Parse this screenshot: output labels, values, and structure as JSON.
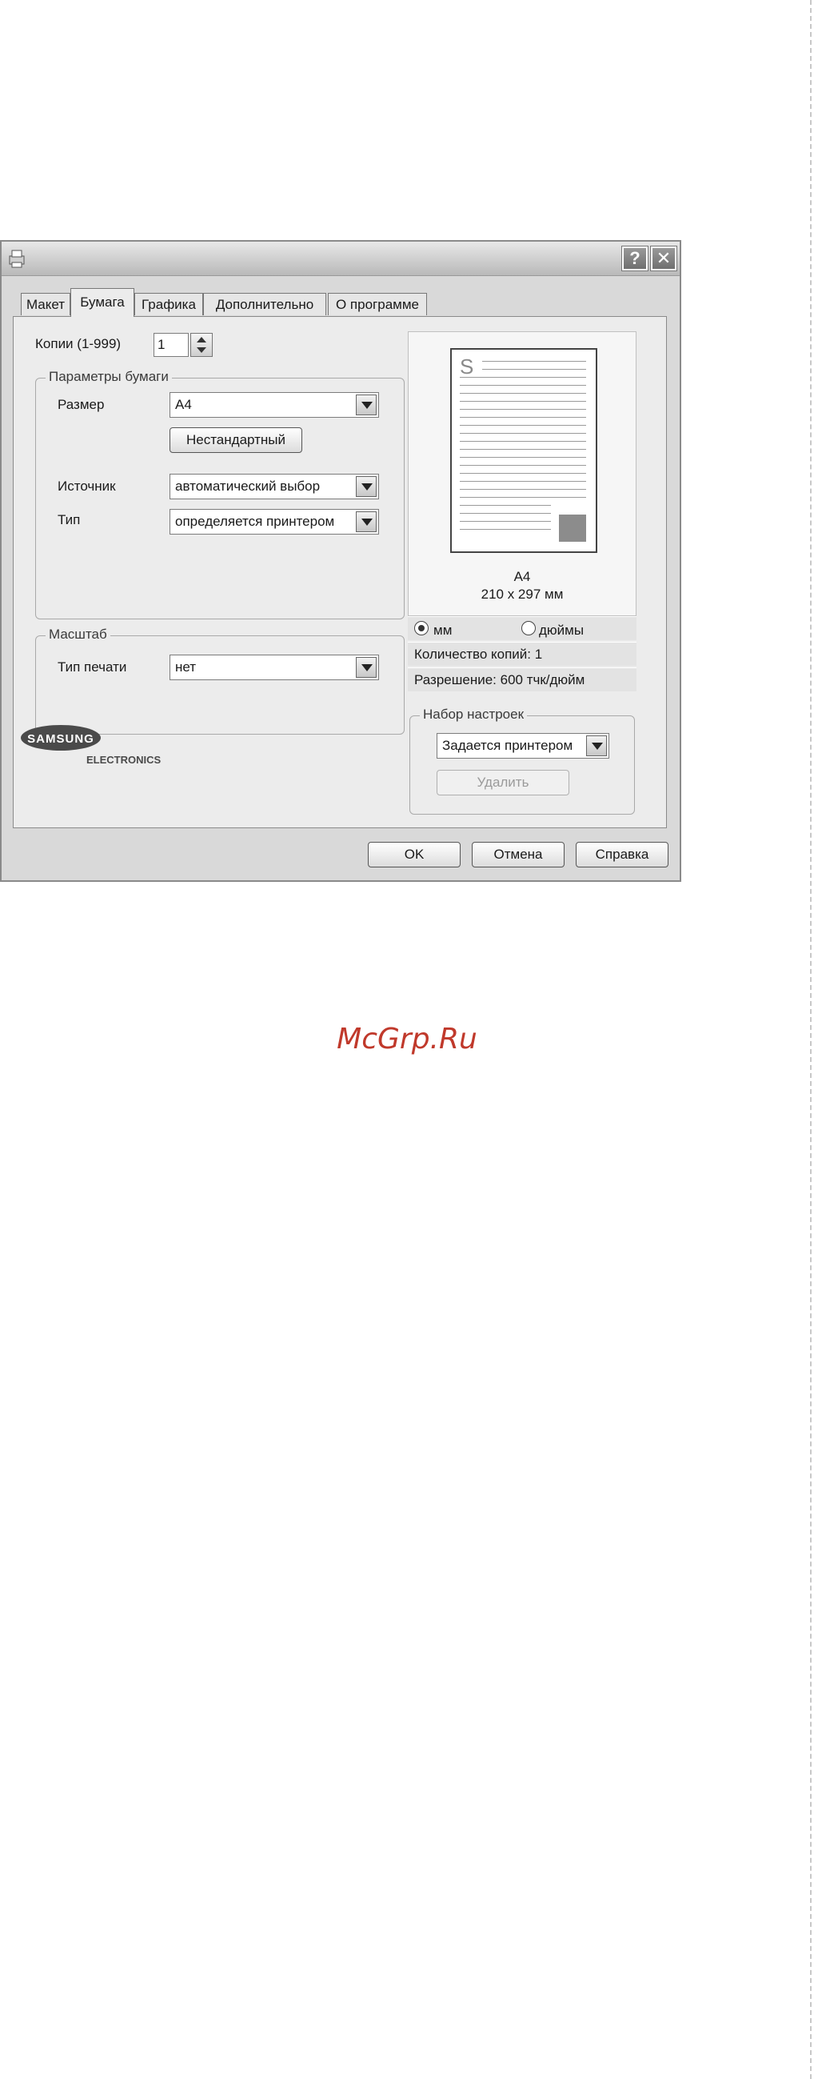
{
  "dialog": {
    "title_buttons": {
      "help": "?",
      "close": "✕"
    },
    "tabs": [
      {
        "label": "Макет"
      },
      {
        "label": "Бумага"
      },
      {
        "label": "Графика"
      },
      {
        "label": "Дополнительно"
      },
      {
        "label": "О программе"
      }
    ],
    "copies": {
      "label": "Копии (1-999)",
      "value": "1"
    },
    "paper_group": {
      "title": "Параметры бумаги",
      "size_label": "Размер",
      "size_value": "A4",
      "custom_button": "Нестандартный",
      "source_label": "Источник",
      "source_value": "автоматический выбор",
      "type_label": "Тип",
      "type_value": "определяется принтером"
    },
    "scale_group": {
      "title": "Масштаб",
      "print_type_label": "Тип печати",
      "print_type_value": "нет"
    },
    "preview": {
      "page_letter": "S",
      "paper_name": "A4",
      "paper_dims": "210 x 297 мм",
      "units_mm": "мм",
      "units_inch": "дюймы",
      "selected_unit": "мм",
      "copies_info": "Количество копий: 1",
      "resolution_info": "Разрешение: 600 тчк/дюйм"
    },
    "presets_group": {
      "title": "Набор настроек",
      "preset_value": "Задается принтером",
      "delete_button": "Удалить"
    },
    "logo": {
      "brand": "SAMSUNG",
      "sub": "ELECTRONICS"
    },
    "footer_buttons": {
      "ok": "OK",
      "cancel": "Отмена",
      "help": "Справка"
    }
  },
  "watermark": "McGrp.Ru"
}
